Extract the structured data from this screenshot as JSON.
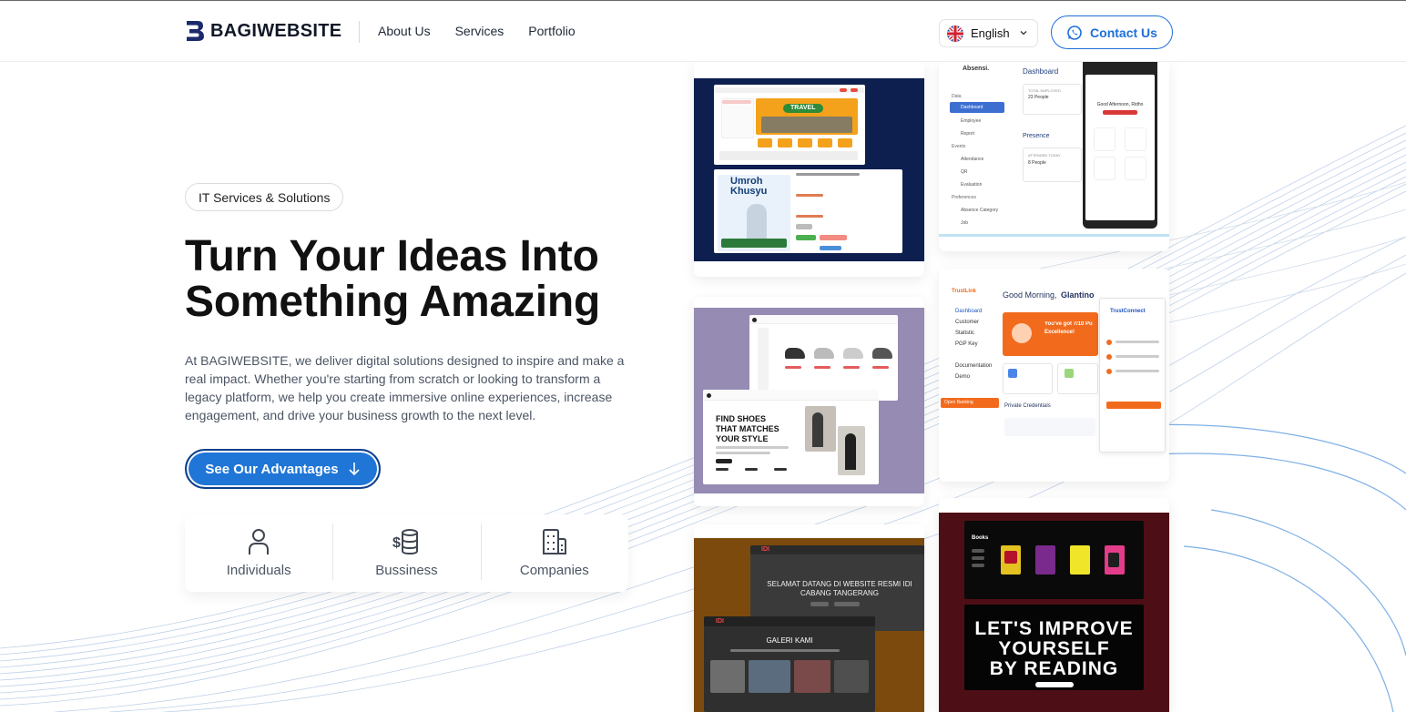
{
  "brand": {
    "name": "BAGIWEBSITE",
    "accent": "#1e6fd9",
    "dark": "#1a2a6c"
  },
  "nav": {
    "items": [
      "About Us",
      "Services",
      "Portfolio"
    ]
  },
  "language": {
    "selected": "English"
  },
  "contact": {
    "label": "Contact Us"
  },
  "hero": {
    "badge": "IT Services & Solutions",
    "title_line1": "Turn Your Ideas Into",
    "title_line2": "Something Amazing",
    "description": "At BAGIWEBSITE, we deliver digital solutions designed to inspire and make a real impact. Whether you're starting from scratch or looking to transform a legacy platform, we help you create immersive online experiences, increase engagement, and drive your business growth to the next level.",
    "cta_label": "See Our Advantages"
  },
  "audience": [
    {
      "label": "Individuals",
      "icon": "person-icon"
    },
    {
      "label": "Bussiness",
      "icon": "dollar-database-icon"
    },
    {
      "label": "Companies",
      "icon": "building-icon"
    }
  ],
  "portfolio": {
    "travel": {
      "banner": "TRAVEL",
      "product": "Umroh Khusyu"
    },
    "absensi": {
      "app": "Absensi.",
      "dashboard": "Dashboard",
      "presence": "Presence",
      "employed": "TOTAL EMPLOYED",
      "employed_value": "23 People",
      "attend": "ATTENDED TODAY",
      "attend_value": "8 People",
      "greeting": "Good Afternoon, Ridho",
      "menu": [
        "Data",
        "Dashboard",
        "Employee",
        "Report",
        "Events",
        "Attendance",
        "QR",
        "Evaluation",
        "Preferences",
        "Absence Category",
        "Job"
      ]
    },
    "shoes": {
      "headline_1": "FIND SHOES",
      "headline_2": "THAT MATCHES",
      "headline_3": "YOUR STYLE"
    },
    "trust": {
      "brand": "TrustLink",
      "greeting_prefix": "Good Morning, ",
      "greeting_name": "Glantino",
      "promo_1": "You've got 7/10 Pu",
      "promo_2": "Excellence!",
      "menu": [
        "Dashboard",
        "Customer",
        "Statistic",
        "PGP Key",
        "Documentation",
        "Demo"
      ],
      "open_banking": "Open Banking",
      "credentials": "Private Credentials",
      "connect": "TrustConnect"
    },
    "idi": {
      "welcome_1": "SELAMAT DATANG DI WEBSITE RESMI IDI",
      "welcome_2": "CABANG TANGERANG",
      "gallery": "GALERI KAMI",
      "logo": "IDI"
    },
    "books": {
      "section": "Books",
      "headline_1": "LET'S IMPROVE",
      "headline_2": "YOURSELF",
      "headline_3": "BY READING"
    }
  }
}
